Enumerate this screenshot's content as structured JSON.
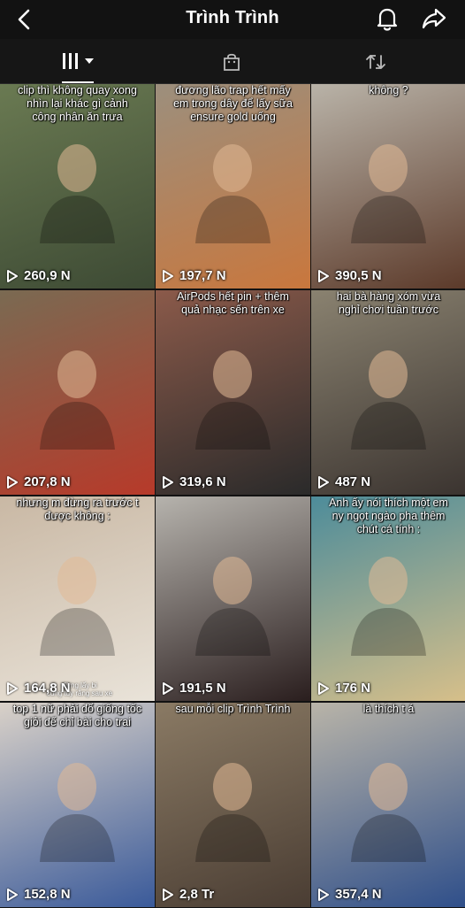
{
  "header": {
    "title": "Trình Trình"
  },
  "tabs": [
    {
      "name": "videos",
      "icon": "grid-bars-icon"
    },
    {
      "name": "shop",
      "icon": "shopping-bag-icon"
    },
    {
      "name": "reposts",
      "icon": "repost-icon"
    }
  ],
  "videos": [
    {
      "caption": "clip thì không quay xong\nnhìn lại khác gì cảnh\ncông nhân ăn trưa",
      "views": "260,9 N",
      "colors": [
        "#6a7a52",
        "#3d4a34"
      ]
    },
    {
      "caption": "đương lão trap hết mấy\nem trong dây để lấy sữa\nensure gold uống",
      "views": "197,7 N",
      "colors": [
        "#9c8f7d",
        "#c9773d"
      ]
    },
    {
      "caption": "không ?",
      "views": "390,5 N",
      "colors": [
        "#b9b3a8",
        "#5c3a2a"
      ]
    },
    {
      "caption": "",
      "views": "207,8 N",
      "colors": [
        "#7a6a52",
        "#b73a2a"
      ]
    },
    {
      "caption": "AirPods hết pin + thêm\nquả nhạc sến trên xe",
      "views": "319,6 N",
      "colors": [
        "#8b5a4a",
        "#2a2a2a"
      ]
    },
    {
      "caption": "hai bà hàng xóm vừa\nnghỉ chơi tuần trước",
      "views": "487 N",
      "colors": [
        "#8a8270",
        "#3b3430"
      ]
    },
    {
      "caption": "nhưng m đừng ra trước t\nđược không :",
      "views": "164,8 N",
      "colors": [
        "#c9b8a4",
        "#e9e3d9"
      ],
      "sub": "đừng lấy bi\ncủng tuy rằng sau xe"
    },
    {
      "caption": "",
      "views": "191,5 N",
      "colors": [
        "#b6b3ad",
        "#2a1e1e"
      ]
    },
    {
      "caption": "Anh ấy nói thích một em\nny ngọt ngào pha thêm\nchút cá tính :",
      "views": "176 N",
      "colors": [
        "#4d8c9a",
        "#d6bf8a"
      ]
    },
    {
      "caption": "top 1 nữ phải đổ giống tốc\ngiỏi đế chỉ bài cho trai",
      "views": "152,8 N",
      "colors": [
        "#d9d1c8",
        "#3a5a9a"
      ]
    },
    {
      "caption": "sau mỗi clip Trình Trình",
      "views": "2,8 Tr",
      "colors": [
        "#8a7a64",
        "#4a3d33"
      ]
    },
    {
      "caption": "là thích t á",
      "views": "357,4 N",
      "colors": [
        "#b9b4a8",
        "#2f4f8a"
      ]
    }
  ]
}
